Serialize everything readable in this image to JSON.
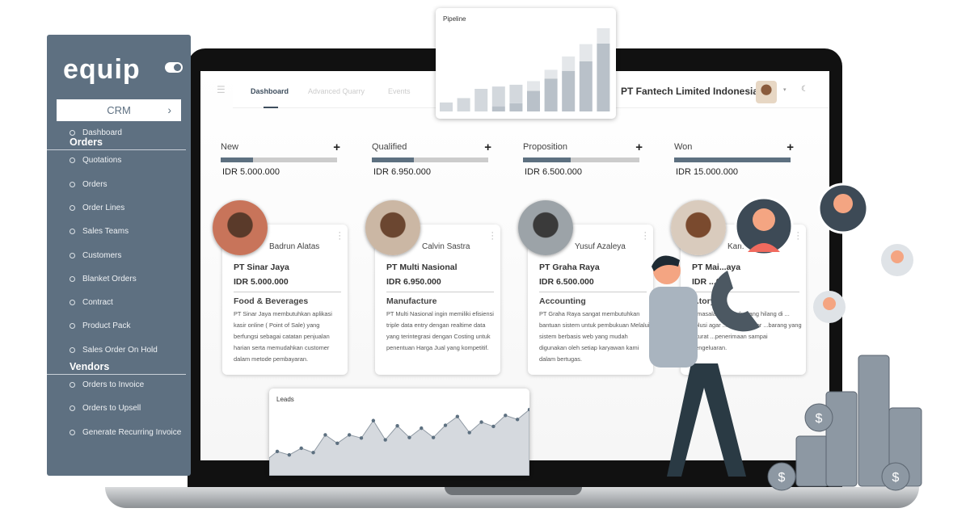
{
  "sidebar": {
    "logo": "equip",
    "module": "CRM",
    "items_top": [
      {
        "label": "Dashboard"
      }
    ],
    "sections": [
      {
        "title": "Orders",
        "items": [
          {
            "label": "Quotations"
          },
          {
            "label": "Orders"
          },
          {
            "label": "Order Lines"
          },
          {
            "label": "Sales Teams"
          },
          {
            "label": "Customers"
          },
          {
            "label": "Blanket Orders"
          },
          {
            "label": "Contract"
          },
          {
            "label": "Product Pack"
          },
          {
            "label": "Sales Order  On Hold"
          }
        ]
      },
      {
        "title": "Vendors",
        "items": [
          {
            "label": "Orders to Invoice"
          },
          {
            "label": "Orders to Upsell"
          },
          {
            "label": "Generate Recurring Invoice"
          }
        ]
      }
    ]
  },
  "header": {
    "tabs": [
      {
        "label": "Dashboard",
        "active": true
      },
      {
        "label": "Advanced Quarry"
      },
      {
        "label": "Events"
      }
    ],
    "company": "PT Fantech Limited Indonesia"
  },
  "stages": [
    {
      "label": "New",
      "amount": "IDR 5.000.000",
      "progress": 0.28
    },
    {
      "label": "Qualified",
      "amount": "IDR 6.950.000",
      "progress": 0.36
    },
    {
      "label": "Proposition",
      "amount": "IDR 6.500.000",
      "progress": 0.41
    },
    {
      "label": "Won",
      "amount": "IDR 15.000.000",
      "progress": 1.0
    }
  ],
  "cards": [
    {
      "name": "Badrun Alatas",
      "company": "PT Sinar Jaya",
      "value": "IDR 5.000.000",
      "industry": "Food & Beverages",
      "description": "PT Sinar Jaya membutuhkan aplikasi kasir online ( Point of Sale) yang berfungsi sebagai catatan penjualan harian serta memudahkan customer dalam metode pembayaran."
    },
    {
      "name": "Calvin Sastra",
      "company": "PT Multi Nasional",
      "value": "IDR 6.950.000",
      "industry": "Manufacture",
      "description": "PT Multi Nasional ingin memiliki efisiensi triple data entry dengan realtime data yang terintegrasi dengan Costing untuk penentuan Harga Jual yang kompetitif."
    },
    {
      "name": "Yusuf Azaleya",
      "company": "PT Graha Raya",
      "value": "IDR 6.500.000",
      "industry": "Accounting",
      "description": "PT Graha Raya sangat membutuhkan bantuan sistem untuk pembukuan Melalui sistem berbasis web yang mudah digunakan oleh setiap karyawan kami dalam bertugas."
    },
    {
      "name": "Karl...",
      "company": "PT Mai...aya",
      "value": "IDR ...000",
      "industry": "...tory",
      "description": "...masalahan untuk ...ang hilang di ... solusi agar ... human error ...barang yang akurat ...penerimaan sampai pengeluaran."
    }
  ],
  "chart_data": [
    {
      "type": "bar",
      "title": "Pipeline",
      "stacked": true,
      "categories": [
        "1",
        "2",
        "3",
        "4",
        "5",
        "6",
        "7",
        "8",
        "9",
        "10"
      ],
      "series": [
        {
          "values": [
            0,
            0,
            0,
            20,
            32,
            80,
            128,
            158,
            195,
            264
          ],
          "color": "#b9c1c9"
        },
        {
          "values": [
            35,
            52,
            88,
            77,
            72,
            38,
            34,
            56,
            67,
            60
          ],
          "color": "#d3d8dd"
        }
      ]
    },
    {
      "type": "area",
      "title": "Leads",
      "values": [
        78,
        66,
        89,
        74,
        135,
        106,
        135,
        124,
        184,
        118,
        166,
        126,
        158,
        126,
        168,
        198,
        143,
        179,
        164,
        202,
        188,
        222
      ],
      "color": "#5d7080",
      "fill": "#d5d9de"
    }
  ],
  "colors": {
    "sidebar": "#5e7081",
    "accent": "#5d7080"
  }
}
